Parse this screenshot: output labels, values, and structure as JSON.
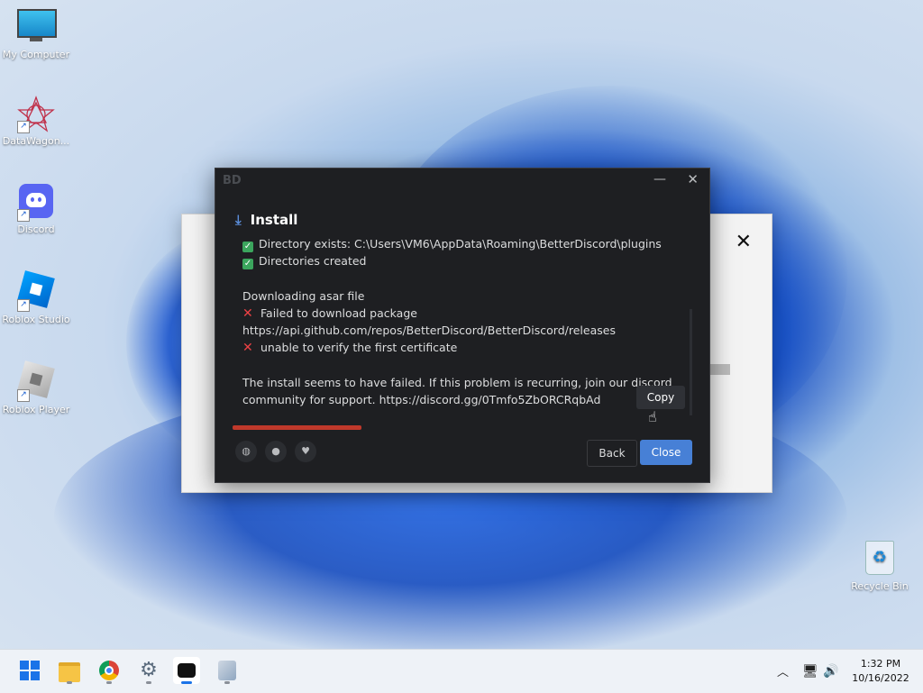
{
  "desktop": {
    "icons": [
      {
        "label": "My Computer",
        "icon": "computer-icon"
      },
      {
        "label": "DataWagon...",
        "icon": "datawagon-icon"
      },
      {
        "label": "Discord",
        "icon": "discord-icon"
      },
      {
        "label": "Roblox Studio",
        "icon": "roblox-studio-icon"
      },
      {
        "label": "Roblox Player",
        "icon": "roblox-player-icon"
      },
      {
        "label": "Recycle Bin",
        "icon": "recycle-bin-icon"
      }
    ]
  },
  "background_window": {
    "close_glyph": "✕"
  },
  "dialog": {
    "logo": "BD",
    "minimize_glyph": "—",
    "close_glyph": "✕",
    "title": "Install",
    "log": [
      {
        "type": "ok",
        "text": "Directory exists: C:\\Users\\VM6\\AppData\\Roaming\\BetterDiscord\\plugins"
      },
      {
        "type": "ok",
        "text": "Directories created"
      },
      {
        "type": "blank",
        "text": ""
      },
      {
        "type": "text",
        "text": "Downloading asar file"
      },
      {
        "type": "err",
        "text": "Failed to download package"
      },
      {
        "type": "text",
        "text": "https://api.github.com/repos/BetterDiscord/BetterDiscord/releases"
      },
      {
        "type": "err",
        "text": "unable to verify the first certificate"
      },
      {
        "type": "blank",
        "text": ""
      },
      {
        "type": "text",
        "text": "The install seems to have failed. If this problem is recurring, join our discord"
      },
      {
        "type": "text",
        "text": "community for support. https://discord.gg/0Tmfo5ZbORCRqbAd"
      }
    ],
    "copy_label": "Copy",
    "progress_fraction": 0.28,
    "back_label": "Back",
    "close_label": "Close",
    "colors": {
      "accent": "#4780d6",
      "progress": "#c0392b",
      "ok": "#3ba55d",
      "error": "#ed4245"
    }
  },
  "taskbar": {
    "icons": [
      "windows-start-icon",
      "file-explorer-icon",
      "chrome-icon",
      "settings-icon",
      "betterdiscord-icon",
      "installer-icon"
    ],
    "tray": {
      "chevron": "^"
    },
    "time": "1:32 PM",
    "date": "10/16/2022"
  }
}
